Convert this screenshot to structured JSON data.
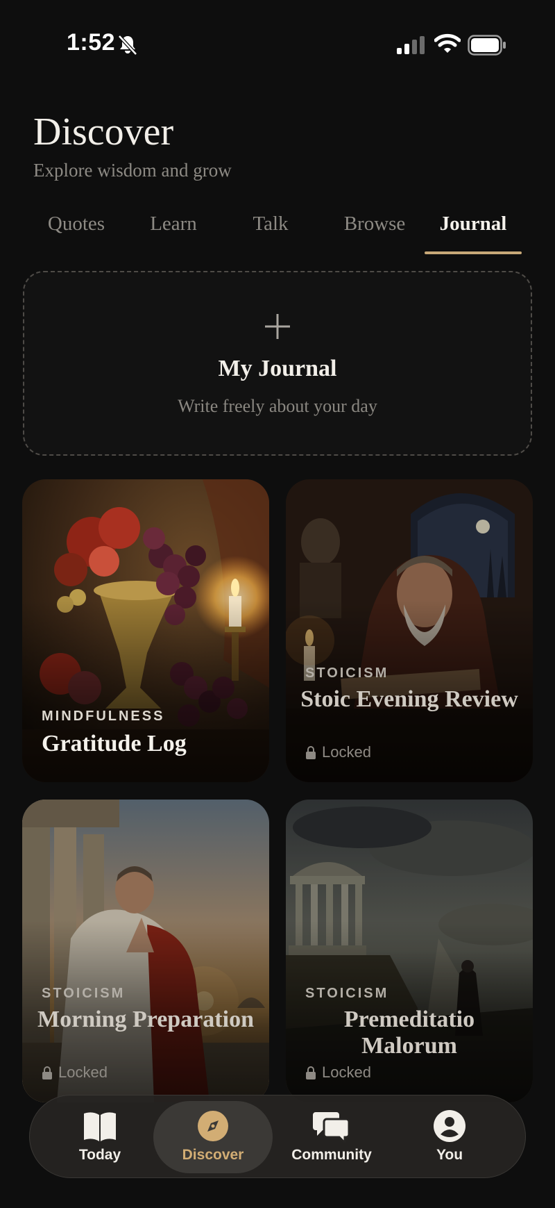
{
  "status_bar": {
    "time": "1:52"
  },
  "header": {
    "title": "Discover",
    "subtitle": "Explore wisdom and grow"
  },
  "tabs": [
    {
      "label": "Quotes",
      "active": false
    },
    {
      "label": "Learn",
      "active": false
    },
    {
      "label": "Talk",
      "active": false
    },
    {
      "label": "Browse",
      "active": false
    },
    {
      "label": "Journal",
      "active": true
    }
  ],
  "new_journal": {
    "title": "My Journal",
    "subtitle": "Write freely about your day"
  },
  "cards": [
    {
      "category": "MINDFULNESS",
      "title": "Gratitude Log",
      "locked": false,
      "art": "fruit-still-life"
    },
    {
      "category": "STOICISM",
      "title": "Stoic Evening Review",
      "locked": true,
      "lock_label": "Locked",
      "art": "philosopher-writing-by-candle"
    },
    {
      "category": "STOICISM",
      "title": "Morning Preparation",
      "locked": true,
      "lock_label": "Locked",
      "art": "roman-praying-at-sunrise"
    },
    {
      "category": "STOICISM",
      "title": "Premeditatio Malorum",
      "locked": true,
      "lock_label": "Locked",
      "art": "figure-before-ruined-temple"
    }
  ],
  "bottom_nav": [
    {
      "label": "Today",
      "icon": "book-icon",
      "active": false
    },
    {
      "label": "Discover",
      "icon": "compass-icon",
      "active": true
    },
    {
      "label": "Community",
      "icon": "chat-bubbles-icon",
      "active": false
    },
    {
      "label": "You",
      "icon": "person-icon",
      "active": false
    }
  ],
  "colors": {
    "accent": "#c8a878",
    "background": "#0e0e0e",
    "nav_active_text": "#d2ad74"
  }
}
